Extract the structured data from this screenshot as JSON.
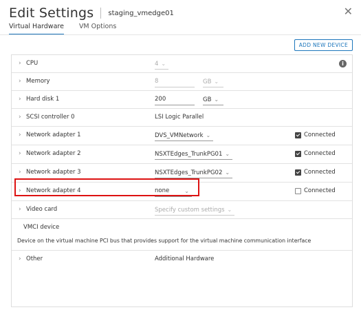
{
  "header": {
    "title": "Edit Settings",
    "vm_name": "staging_vmedge01"
  },
  "tabs": [
    {
      "label": "Virtual Hardware"
    },
    {
      "label": "VM Options"
    }
  ],
  "toolbar": {
    "add_new_device": "ADD NEW DEVICE"
  },
  "hardware": {
    "cpu": {
      "label": "CPU",
      "value": "4"
    },
    "memory": {
      "label": "Memory",
      "value": "8",
      "unit": "GB"
    },
    "hard_disk": {
      "label": "Hard disk 1",
      "value": "200",
      "unit": "GB"
    },
    "scsi": {
      "label": "SCSI controller 0",
      "value": "LSI Logic Parallel"
    },
    "net1": {
      "label": "Network adapter 1",
      "network": "DVS_VMNetwork",
      "connected_label": "Connected",
      "connected": true
    },
    "net2": {
      "label": "Network adapter 2",
      "network": "NSXTEdges_TrunkPG01",
      "connected_label": "Connected",
      "connected": true
    },
    "net3": {
      "label": "Network adapter 3",
      "network": "NSXTEdges_TrunkPG02",
      "connected_label": "Connected",
      "connected": true
    },
    "net4": {
      "label": "Network adapter 4",
      "network": "none",
      "connected_label": "Connected",
      "connected": false
    },
    "video": {
      "label": "Video card",
      "value": "Specify custom settings"
    },
    "vmci": {
      "label": "VMCI device",
      "description": "Device on the virtual machine PCI bus that provides support for the virtual machine communication interface"
    },
    "other": {
      "label": "Other",
      "value": "Additional Hardware"
    }
  },
  "colors": {
    "accent": "#1b75bb",
    "highlight": "#dd1111"
  }
}
